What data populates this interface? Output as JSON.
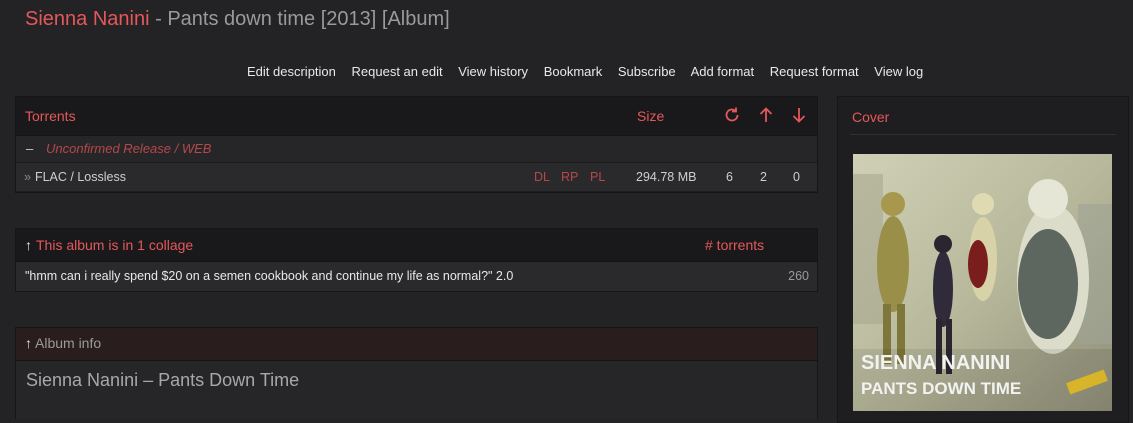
{
  "header": {
    "artist": "Sienna Nanini",
    "separator": " - ",
    "album": "Pants down time [2013] [Album]"
  },
  "links": [
    "Edit description",
    "Request an edit",
    "View history",
    "Bookmark",
    "Subscribe",
    "Add format",
    "Request format",
    "View log"
  ],
  "torrents": {
    "header": "Torrents",
    "size_header": "Size",
    "icons": [
      "snatches-icon",
      "seeders-icon",
      "leechers-icon"
    ],
    "edition_toggle": "–",
    "edition": "Unconfirmed Release / WEB",
    "rows": [
      {
        "prefix": "»",
        "format": "FLAC / Lossless",
        "actions": [
          "DL",
          "RP",
          "PL"
        ],
        "size": "294.78 MB",
        "snatches": "6",
        "seeders": "2",
        "leechers": "0"
      }
    ]
  },
  "collage": {
    "arrow": "↑",
    "header": "This album is in 1 collage",
    "torrents_header": "# torrents",
    "items": [
      {
        "name": "\"hmm can i really spend $20 on a semen cookbook and continue my life as normal?\" 2.0",
        "count": "260"
      }
    ]
  },
  "album_info": {
    "arrow": "↑",
    "header": "Album info",
    "text": "Sienna Nanini – Pants Down Time"
  },
  "cover": {
    "header": "Cover",
    "art_line1": "SIENNA NANINI",
    "art_line2": "PANTS DOWN TIME"
  },
  "colors": {
    "accent": "#e5585a",
    "background": "#232326"
  }
}
